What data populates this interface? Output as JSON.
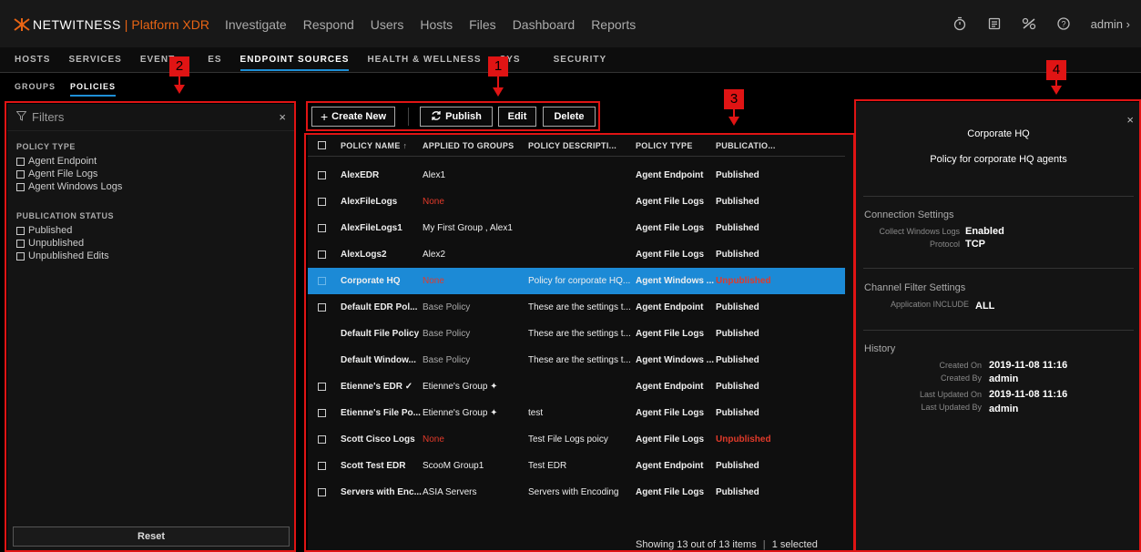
{
  "brand": {
    "name": "NETWITNESS",
    "separator": "|",
    "product": "Platform XDR"
  },
  "main_nav": [
    "Investigate",
    "Respond",
    "Users",
    "Hosts",
    "Files",
    "Dashboard",
    "Reports"
  ],
  "user": "admin",
  "sub_nav": [
    {
      "label": "HOSTS",
      "active": false
    },
    {
      "label": "SERVICES",
      "active": false
    },
    {
      "label": "EVENT",
      "active": false
    },
    {
      "label": "ES",
      "active": false
    },
    {
      "label": "ENDPOINT SOURCES",
      "active": true
    },
    {
      "label": "HEALTH & WELLNESS",
      "active": false
    },
    {
      "label": "SYS",
      "active": false
    },
    {
      "label": "SECURITY",
      "active": false
    }
  ],
  "tabs": [
    {
      "label": "GROUPS"
    },
    {
      "label": "POLICIES"
    }
  ],
  "callouts": [
    "1",
    "2",
    "3",
    "4"
  ],
  "filters": {
    "title": "Filters",
    "policy_type": {
      "title": "POLICY TYPE",
      "options": [
        "Agent Endpoint",
        "Agent File Logs",
        "Agent Windows Logs"
      ]
    },
    "publication_status": {
      "title": "PUBLICATION STATUS",
      "options": [
        "Published",
        "Unpublished",
        "Unpublished Edits"
      ]
    },
    "reset_label": "Reset"
  },
  "toolbar": {
    "create": "Create New",
    "publish": "Publish",
    "edit": "Edit",
    "delete": "Delete"
  },
  "table": {
    "headers": [
      "POLICY NAME",
      "APPLIED TO GROUPS",
      "POLICY DESCRIPTI...",
      "POLICY TYPE",
      "PUBLICATIO..."
    ],
    "sort_indicator": "↑",
    "rows": [
      {
        "name": "AlexEDR",
        "groups": "Alex1",
        "groups_none": false,
        "desc": "",
        "type": "Agent Endpoint",
        "status": "Published",
        "checkbox": true,
        "selected": false
      },
      {
        "name": "AlexFileLogs",
        "groups": "None",
        "groups_none": true,
        "desc": "",
        "type": "Agent File Logs",
        "status": "Published",
        "checkbox": true,
        "selected": false
      },
      {
        "name": "AlexFileLogs1",
        "groups": "My First Group , Alex1",
        "groups_none": false,
        "desc": "",
        "type": "Agent File Logs",
        "status": "Published",
        "checkbox": true,
        "selected": false
      },
      {
        "name": "AlexLogs2",
        "groups": "Alex2",
        "groups_none": false,
        "desc": "",
        "type": "Agent File Logs",
        "status": "Published",
        "checkbox": true,
        "selected": false
      },
      {
        "name": "Corporate HQ",
        "groups": "None",
        "groups_none": true,
        "desc": "Policy for corporate HQ...",
        "type": "Agent Windows ...",
        "status": "Unpublished",
        "checkbox": true,
        "selected": true
      },
      {
        "name": "Default EDR Pol...",
        "groups": "Base Policy",
        "groups_none": false,
        "desc": "These are the settings t...",
        "type": "Agent Endpoint",
        "status": "Published",
        "checkbox": true,
        "selected": false
      },
      {
        "name": "Default File Policy",
        "groups": "Base Policy",
        "groups_none": false,
        "desc": "These are the settings t...",
        "type": "Agent File Logs",
        "status": "Published",
        "checkbox": false,
        "selected": false
      },
      {
        "name": "Default Window...",
        "groups": "Base Policy",
        "groups_none": false,
        "desc": "These are the settings t...",
        "type": "Agent Windows ...",
        "status": "Published",
        "checkbox": false,
        "selected": false
      },
      {
        "name": "Etienne's EDR ✓",
        "groups": "Etienne's Group ✦",
        "groups_none": false,
        "desc": "",
        "type": "Agent Endpoint",
        "status": "Published",
        "checkbox": true,
        "selected": false
      },
      {
        "name": "Etienne's File Po...",
        "groups": "Etienne's Group ✦",
        "groups_none": false,
        "desc": "test",
        "type": "Agent File Logs",
        "status": "Published",
        "checkbox": true,
        "selected": false
      },
      {
        "name": "Scott Cisco Logs",
        "groups": "None",
        "groups_none": true,
        "desc": "Test File Logs poicy",
        "type": "Agent File Logs",
        "status": "Unpublished",
        "checkbox": true,
        "selected": false
      },
      {
        "name": "Scott Test EDR",
        "groups": "ScooM Group1",
        "groups_none": false,
        "desc": "Test EDR",
        "type": "Agent Endpoint",
        "status": "Published",
        "checkbox": true,
        "selected": false
      },
      {
        "name": "Servers with Enc...",
        "groups": "ASIA Servers",
        "groups_none": false,
        "desc": "Servers with Encoding",
        "type": "Agent File Logs",
        "status": "Published",
        "checkbox": true,
        "selected": false
      }
    ],
    "footer_count": "Showing 13 out of 13 items",
    "footer_sep": "|",
    "footer_selected": "1 selected"
  },
  "details": {
    "title": "Corporate HQ",
    "subtitle": "Policy for corporate HQ agents",
    "connection": {
      "title": "Connection Settings",
      "items": [
        {
          "key": "Collect Windows Logs",
          "value": "Enabled"
        },
        {
          "key": "Protocol",
          "value": "TCP"
        }
      ]
    },
    "channel": {
      "title": "Channel Filter Settings",
      "items": [
        {
          "key": "Application INCLUDE",
          "value": "ALL"
        }
      ]
    },
    "history": {
      "title": "History",
      "items": [
        {
          "key": "Created On",
          "value": "2019-11-08 11:16"
        },
        {
          "key": "Created By",
          "value": "admin"
        },
        {
          "key": "Last Updated On",
          "value": "2019-11-08 11:16"
        },
        {
          "key": "Last Updated By",
          "value": "admin"
        }
      ]
    }
  },
  "colors": {
    "accent": "#1c8ad6",
    "brand": "#e86414",
    "callout": "#e01414",
    "unpublished": "#e23a2a"
  }
}
